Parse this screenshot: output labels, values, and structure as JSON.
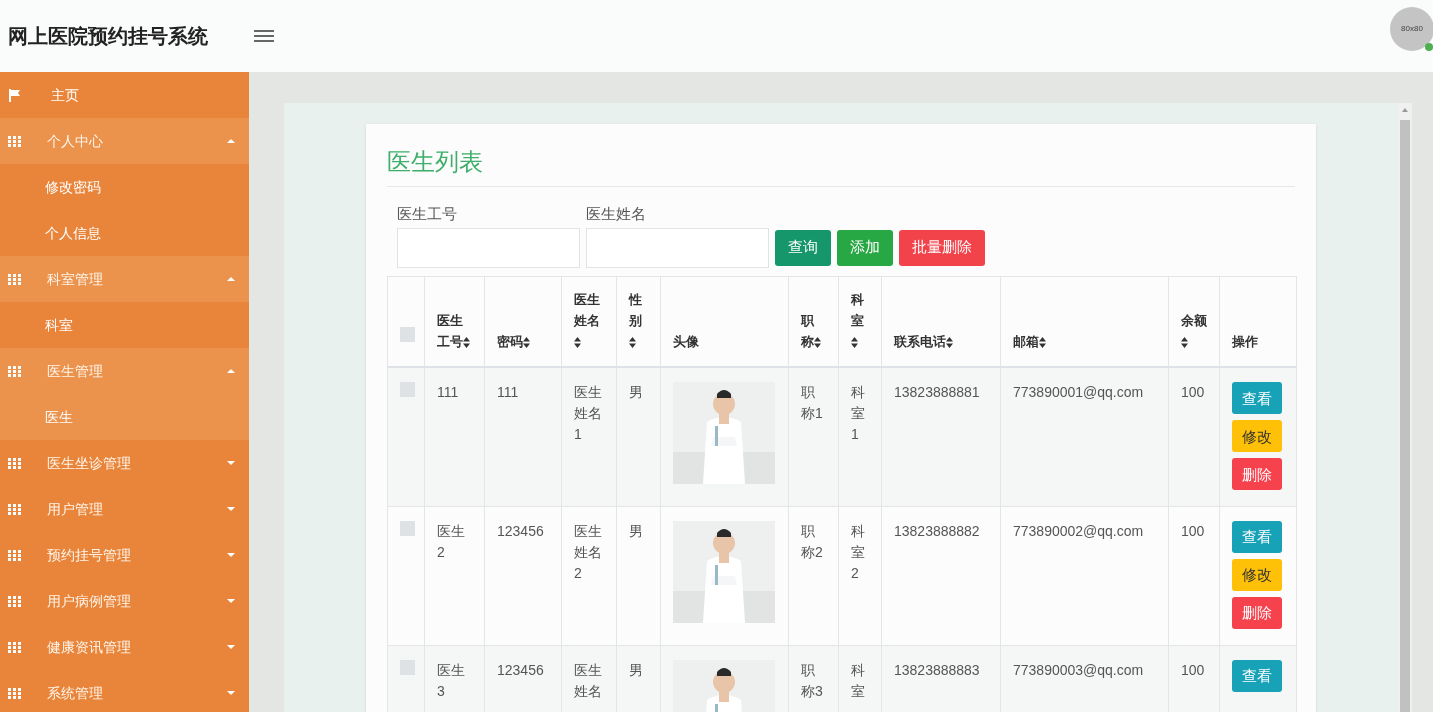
{
  "header": {
    "title": "网上医院预约挂号系统",
    "avatar": "80x80",
    "online": true
  },
  "sidebar": {
    "items": [
      {
        "kind": "link",
        "label": "主页",
        "selected": false
      },
      {
        "kind": "group",
        "label": "个人中心",
        "expanded": true,
        "children": [
          {
            "label": "修改密码",
            "selected": false
          },
          {
            "label": "个人信息",
            "selected": false
          }
        ]
      },
      {
        "kind": "group",
        "label": "科室管理",
        "expanded": true,
        "children": [
          {
            "label": "科室",
            "selected": false
          }
        ]
      },
      {
        "kind": "group",
        "label": "医生管理",
        "expanded": true,
        "children": [
          {
            "label": "医生",
            "selected": true
          }
        ]
      },
      {
        "kind": "group",
        "label": "医生坐诊管理",
        "expanded": false
      },
      {
        "kind": "group",
        "label": "用户管理",
        "expanded": false
      },
      {
        "kind": "group",
        "label": "预约挂号管理",
        "expanded": false
      },
      {
        "kind": "group",
        "label": "用户病例管理",
        "expanded": false
      },
      {
        "kind": "group",
        "label": "健康资讯管理",
        "expanded": false
      },
      {
        "kind": "group",
        "label": "系统管理",
        "expanded": false
      }
    ]
  },
  "content": {
    "title": "医生列表",
    "filters": [
      {
        "label": "医生工号"
      },
      {
        "label": "医生姓名"
      }
    ],
    "buttons": [
      {
        "kind": "query",
        "label": "查询"
      },
      {
        "kind": "add",
        "label": "添加"
      },
      {
        "kind": "delete",
        "label": "批量删除"
      }
    ],
    "table": {
      "select_all_checked": false,
      "columns": [
        {
          "label": "医生工号",
          "sortable": true
        },
        {
          "label": "密码",
          "sortable": true
        },
        {
          "label": "医生姓名",
          "sortable": true
        },
        {
          "label": "性别",
          "sortable": true
        },
        {
          "label": "头像",
          "sortable": false
        },
        {
          "label": "职称",
          "sortable": true
        },
        {
          "label": "科室",
          "sortable": true
        },
        {
          "label": "联系电话",
          "sortable": true
        },
        {
          "label": "邮箱",
          "sortable": true
        },
        {
          "label": "余额",
          "sortable": true
        },
        {
          "label": "操作",
          "sortable": false
        }
      ],
      "rows": [
        {
          "checked": false,
          "id": "111",
          "password": "111",
          "name": "医生姓名1",
          "gender": "男",
          "avatar": {
            "kind": "picture"
          },
          "title": "职称1",
          "department": "科室1",
          "phone": "13823888881",
          "email": "773890001@qq.com",
          "balance": "100",
          "actions": [
            {
              "kind": "view",
              "label": "查看"
            },
            {
              "kind": "edit",
              "label": "修改"
            },
            {
              "kind": "delete",
              "label": "删除"
            }
          ]
        },
        {
          "checked": false,
          "id": "医生2",
          "password": "123456",
          "name": "医生姓名2",
          "gender": "男",
          "avatar": {
            "kind": "picture"
          },
          "title": "职称2",
          "department": "科室2",
          "phone": "13823888882",
          "email": "773890002@qq.com",
          "balance": "100",
          "actions": [
            {
              "kind": "view",
              "label": "查看"
            },
            {
              "kind": "edit",
              "label": "修改"
            },
            {
              "kind": "delete",
              "label": "删除"
            }
          ]
        },
        {
          "checked": false,
          "id": "医生3",
          "password": "123456",
          "name": "医生姓名",
          "gender": "男",
          "avatar": {
            "kind": "picture"
          },
          "title": "职称3",
          "department": "科室",
          "phone": "13823888883",
          "email": "773890003@qq.com",
          "balance": "100",
          "actions": [
            {
              "kind": "view",
              "label": "查看"
            }
          ]
        }
      ]
    }
  }
}
